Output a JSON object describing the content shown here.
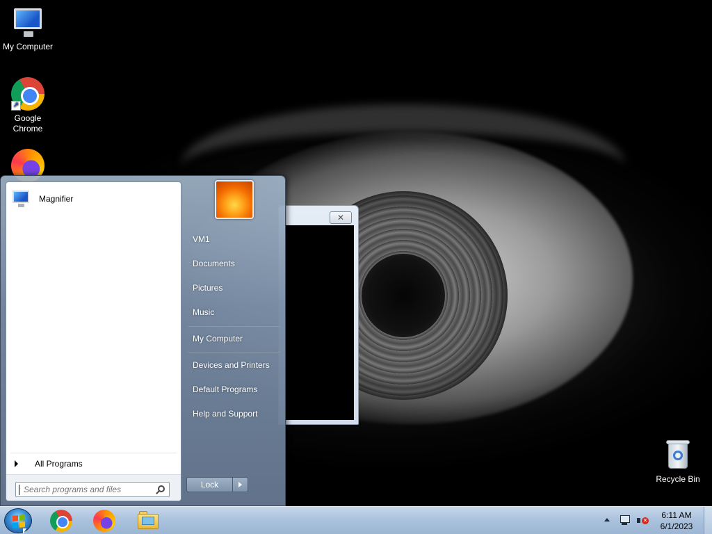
{
  "desktop": {
    "icons": [
      {
        "label": "My Computer",
        "icon": "computer-icon"
      },
      {
        "label": "Google Chrome",
        "icon": "chrome-icon"
      },
      {
        "label": "Firefox",
        "icon": "firefox-icon"
      },
      {
        "label": "Recycle Bin",
        "icon": "recycle-bin-icon"
      }
    ]
  },
  "background_window": {
    "close_symbol": "✕"
  },
  "start_menu": {
    "pinned_programs": [
      {
        "label": "Magnifier",
        "icon": "magnifier-icon"
      }
    ],
    "all_programs_label": "All Programs",
    "search": {
      "placeholder": "Search programs and files",
      "value": ""
    },
    "right_items": [
      {
        "label": "VM1"
      },
      {
        "label": "Documents"
      },
      {
        "label": "Pictures"
      },
      {
        "label": "Music"
      },
      {
        "label": "My Computer"
      },
      {
        "label": "Devices and Printers"
      },
      {
        "label": "Default Programs"
      },
      {
        "label": "Help and Support"
      }
    ],
    "lock_label": "Lock"
  },
  "taskbar": {
    "pinned": [
      {
        "name": "Google Chrome",
        "icon": "chrome-icon"
      },
      {
        "name": "Firefox",
        "icon": "firefox-icon"
      },
      {
        "name": "Windows Explorer",
        "icon": "folder-icon"
      }
    ],
    "clock": {
      "time": "6:11 AM",
      "date": "6/1/2023"
    }
  },
  "colors": {
    "taskbar": "#a9c1dc",
    "start_menu_frame": "#7f93ab",
    "volume_muted": "#d8261c"
  }
}
